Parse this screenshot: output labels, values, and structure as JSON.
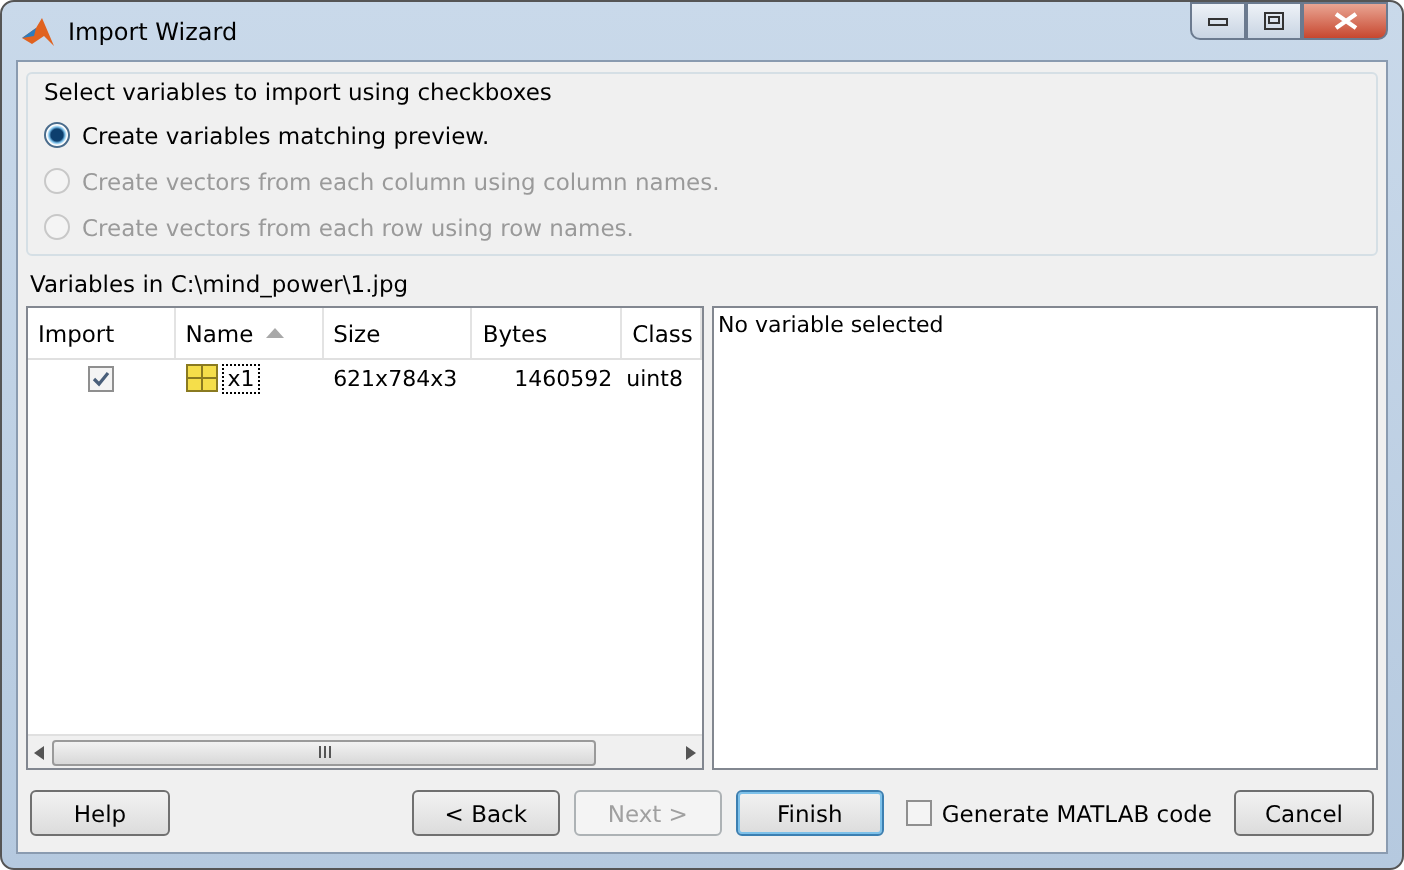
{
  "window": {
    "title": "Import Wizard"
  },
  "options": {
    "title": "Select variables to import using checkboxes",
    "radios": [
      {
        "label": "Create variables matching preview.",
        "selected": true,
        "disabled": false
      },
      {
        "label": "Create vectors from each column using column names.",
        "selected": false,
        "disabled": true
      },
      {
        "label": "Create vectors from each row using row names.",
        "selected": false,
        "disabled": true
      }
    ]
  },
  "source_label": "Variables in C:\\mind_power\\1.jpg",
  "table": {
    "columns": [
      {
        "label": "Import",
        "sorted": false
      },
      {
        "label": "Name",
        "sorted": true
      },
      {
        "label": "Size",
        "sorted": false
      },
      {
        "label": "Bytes",
        "sorted": false
      },
      {
        "label": "Class",
        "sorted": false
      }
    ],
    "rows": [
      {
        "checked": true,
        "name": "x1",
        "size": "621x784x3",
        "bytes": "1460592",
        "class": "uint8"
      }
    ]
  },
  "preview": {
    "text": "No variable selected"
  },
  "buttons": [
    {
      "label": "Help",
      "disabled": false,
      "default": false
    },
    {
      "label": "< Back",
      "disabled": false,
      "default": false
    },
    {
      "label": "Next >",
      "disabled": true,
      "default": false
    },
    {
      "label": "Finish",
      "disabled": false,
      "default": true
    }
  ],
  "generate_code": {
    "label": "Generate MATLAB code",
    "checked": false
  },
  "cancel": {
    "label": "Cancel",
    "disabled": false,
    "default": false
  }
}
